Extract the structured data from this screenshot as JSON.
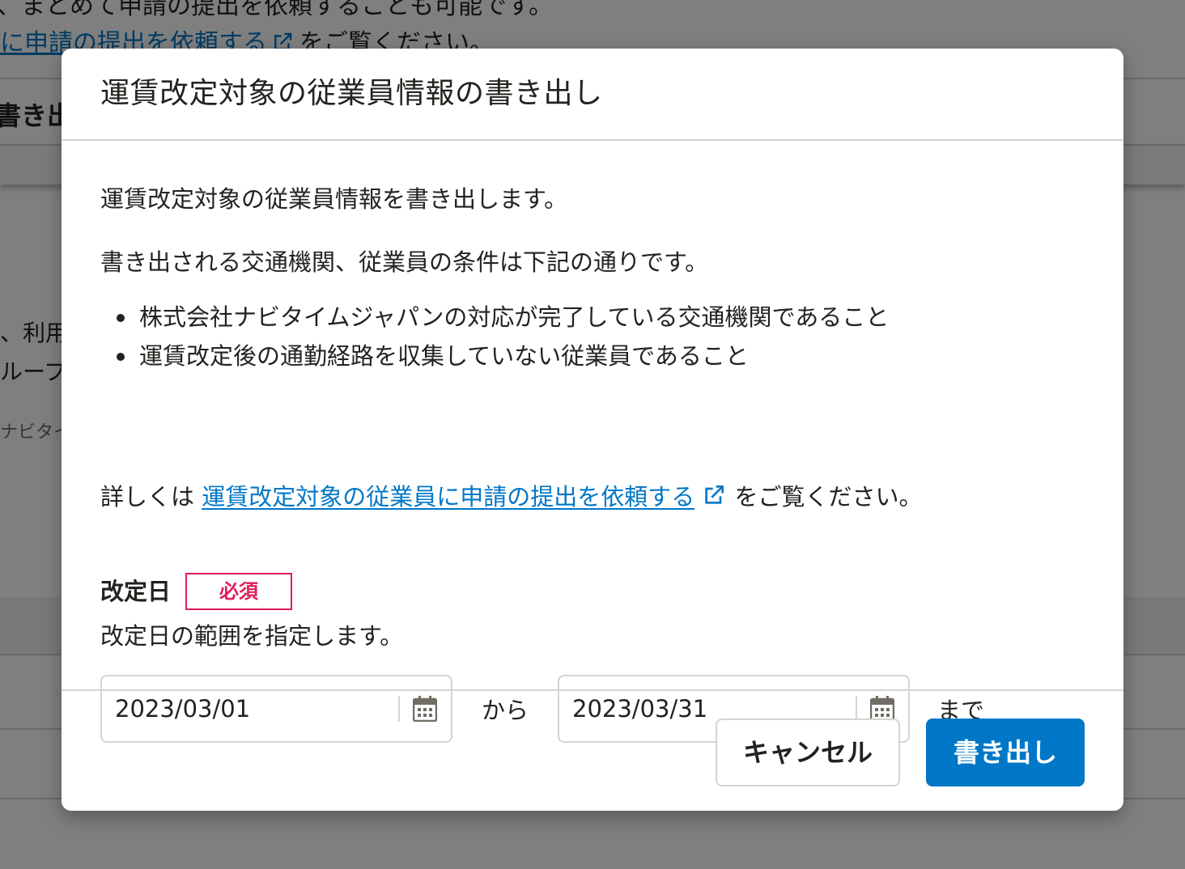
{
  "background": {
    "line1": "、まとめて申請の提出を依頼することも可能です。",
    "line2_link": "に申請の提出を依頼する",
    "line2_suffix": "をご覧ください。",
    "export_label": "書き出",
    "side_line1": "、利用",
    "side_line2": "ループ",
    "side_line3": "ナビタイ"
  },
  "dialog": {
    "title": "運賃改定対象の従業員情報の書き出し",
    "description1": "運賃改定対象の従業員情報を書き出します。",
    "description2": "書き出される交通機関、従業員の条件は下記の通りです。",
    "conditions": [
      "株式会社ナビタイムジャパンの対応が完了している交通機関であること",
      "運賃改定後の通勤経路を収集していない従業員であること"
    ],
    "details_prefix": "詳しくは",
    "details_link": "運賃改定対象の従業員に申請の提出を依頼する",
    "details_suffix": "をご覧ください。",
    "field": {
      "label": "改定日",
      "required_badge": "必須",
      "help_text": "改定日の範囲を指定します。",
      "start_date": "2023/03/01",
      "range_from": "から",
      "end_date": "2023/03/31",
      "range_to": "まで"
    },
    "buttons": {
      "cancel": "キャンセル",
      "export": "書き出し"
    }
  },
  "colors": {
    "primary": "#0077c7",
    "required": "#e01e5a",
    "border": "#d6d3d0",
    "text": "#23221e"
  },
  "icons": {
    "external_link": "external-link-icon",
    "calendar": "calendar-icon"
  }
}
